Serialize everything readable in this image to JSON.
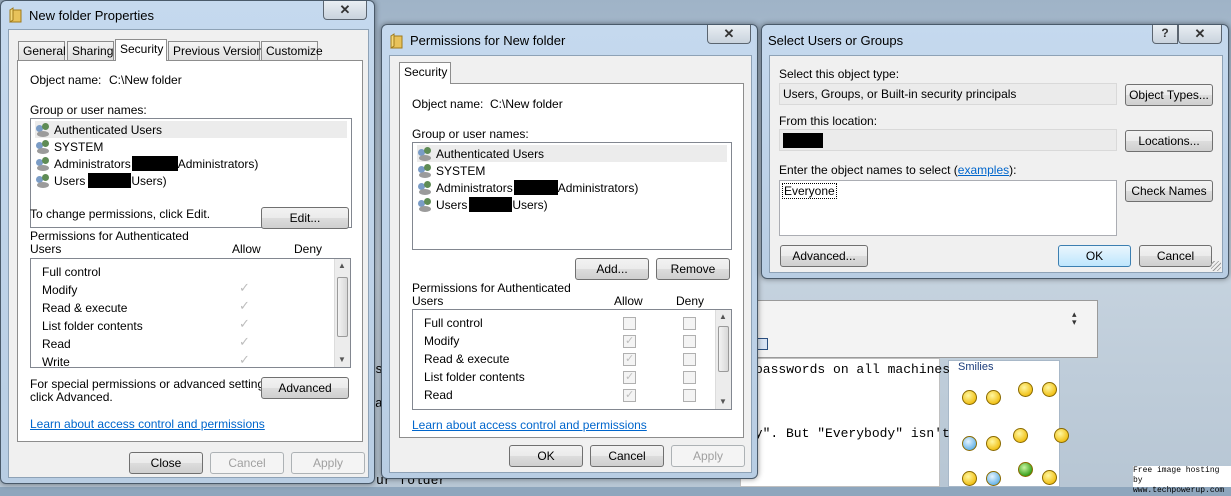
{
  "background": {
    "post_text": {
      "line1": "passwords on all machines",
      "line2_pre": "dy\".  But \"Everybody\" isn't",
      "line3": "ur folder",
      "s1": "s",
      "s2": "a"
    },
    "smilies_title": "Smilies",
    "watermark": {
      "line1": "Free image hosting by",
      "line2": "www.techpowerup.com"
    },
    "colors": {
      "link": "#0066cc",
      "desktop": "#b7c6d4"
    }
  },
  "props": {
    "title": "New folder Properties",
    "tabs": [
      "General",
      "Sharing",
      "Security",
      "Previous Versions",
      "Customize"
    ],
    "object_label": "Object name:",
    "object_value": "C:\\New folder",
    "group_label": "Group or user names:",
    "users": [
      "Authenticated Users",
      "SYSTEM",
      "Administrators",
      "Administrators)",
      "Users",
      "Users)"
    ],
    "change_text": "To change permissions, click Edit.",
    "edit_btn": "Edit...",
    "perm_title": "Permissions for Authenticated",
    "perm_title2": "Users",
    "allow": "Allow",
    "deny": "Deny",
    "perms": [
      "Full control",
      "Modify",
      "Read & execute",
      "List folder contents",
      "Read",
      "Write"
    ],
    "special_text1": "For special permissions or advanced settings,",
    "special_text2": "click Advanced.",
    "advanced_btn": "Advanced",
    "learn_link": "Learn about access control and permissions",
    "close_btn": "Close",
    "cancel_btn": "Cancel",
    "apply_btn": "Apply"
  },
  "perm": {
    "title": "Permissions for New folder",
    "tab": "Security",
    "object_label": "Object name:",
    "object_value": "C:\\New folder",
    "group_label": "Group or user names:",
    "users": [
      "Authenticated Users",
      "SYSTEM",
      "Administrators",
      "Administrators)",
      "Users",
      "Users)"
    ],
    "add_btn": "Add...",
    "remove_btn": "Remove",
    "perm_title": "Permissions for Authenticated",
    "perm_title2": "Users",
    "allow": "Allow",
    "deny": "Deny",
    "perms": [
      "Full control",
      "Modify",
      "Read & execute",
      "List folder contents",
      "Read"
    ],
    "learn_link": "Learn about access control and permissions",
    "ok_btn": "OK",
    "cancel_btn": "Cancel",
    "apply_btn": "Apply"
  },
  "select": {
    "title": "Select Users or Groups",
    "type_label": "Select this object type:",
    "type_value": "Users, Groups, or Built-in security principals",
    "object_types_btn": "Object Types...",
    "location_label": "From this location:",
    "locations_btn": "Locations...",
    "enter_label_pre": "Enter the object names to select (",
    "examples_link": "examples",
    "enter_label_post": "):",
    "names_value": "Everyone",
    "check_names_btn": "Check Names",
    "advanced_btn": "Advanced...",
    "ok_btn": "OK",
    "cancel_btn": "Cancel",
    "help": "?"
  }
}
